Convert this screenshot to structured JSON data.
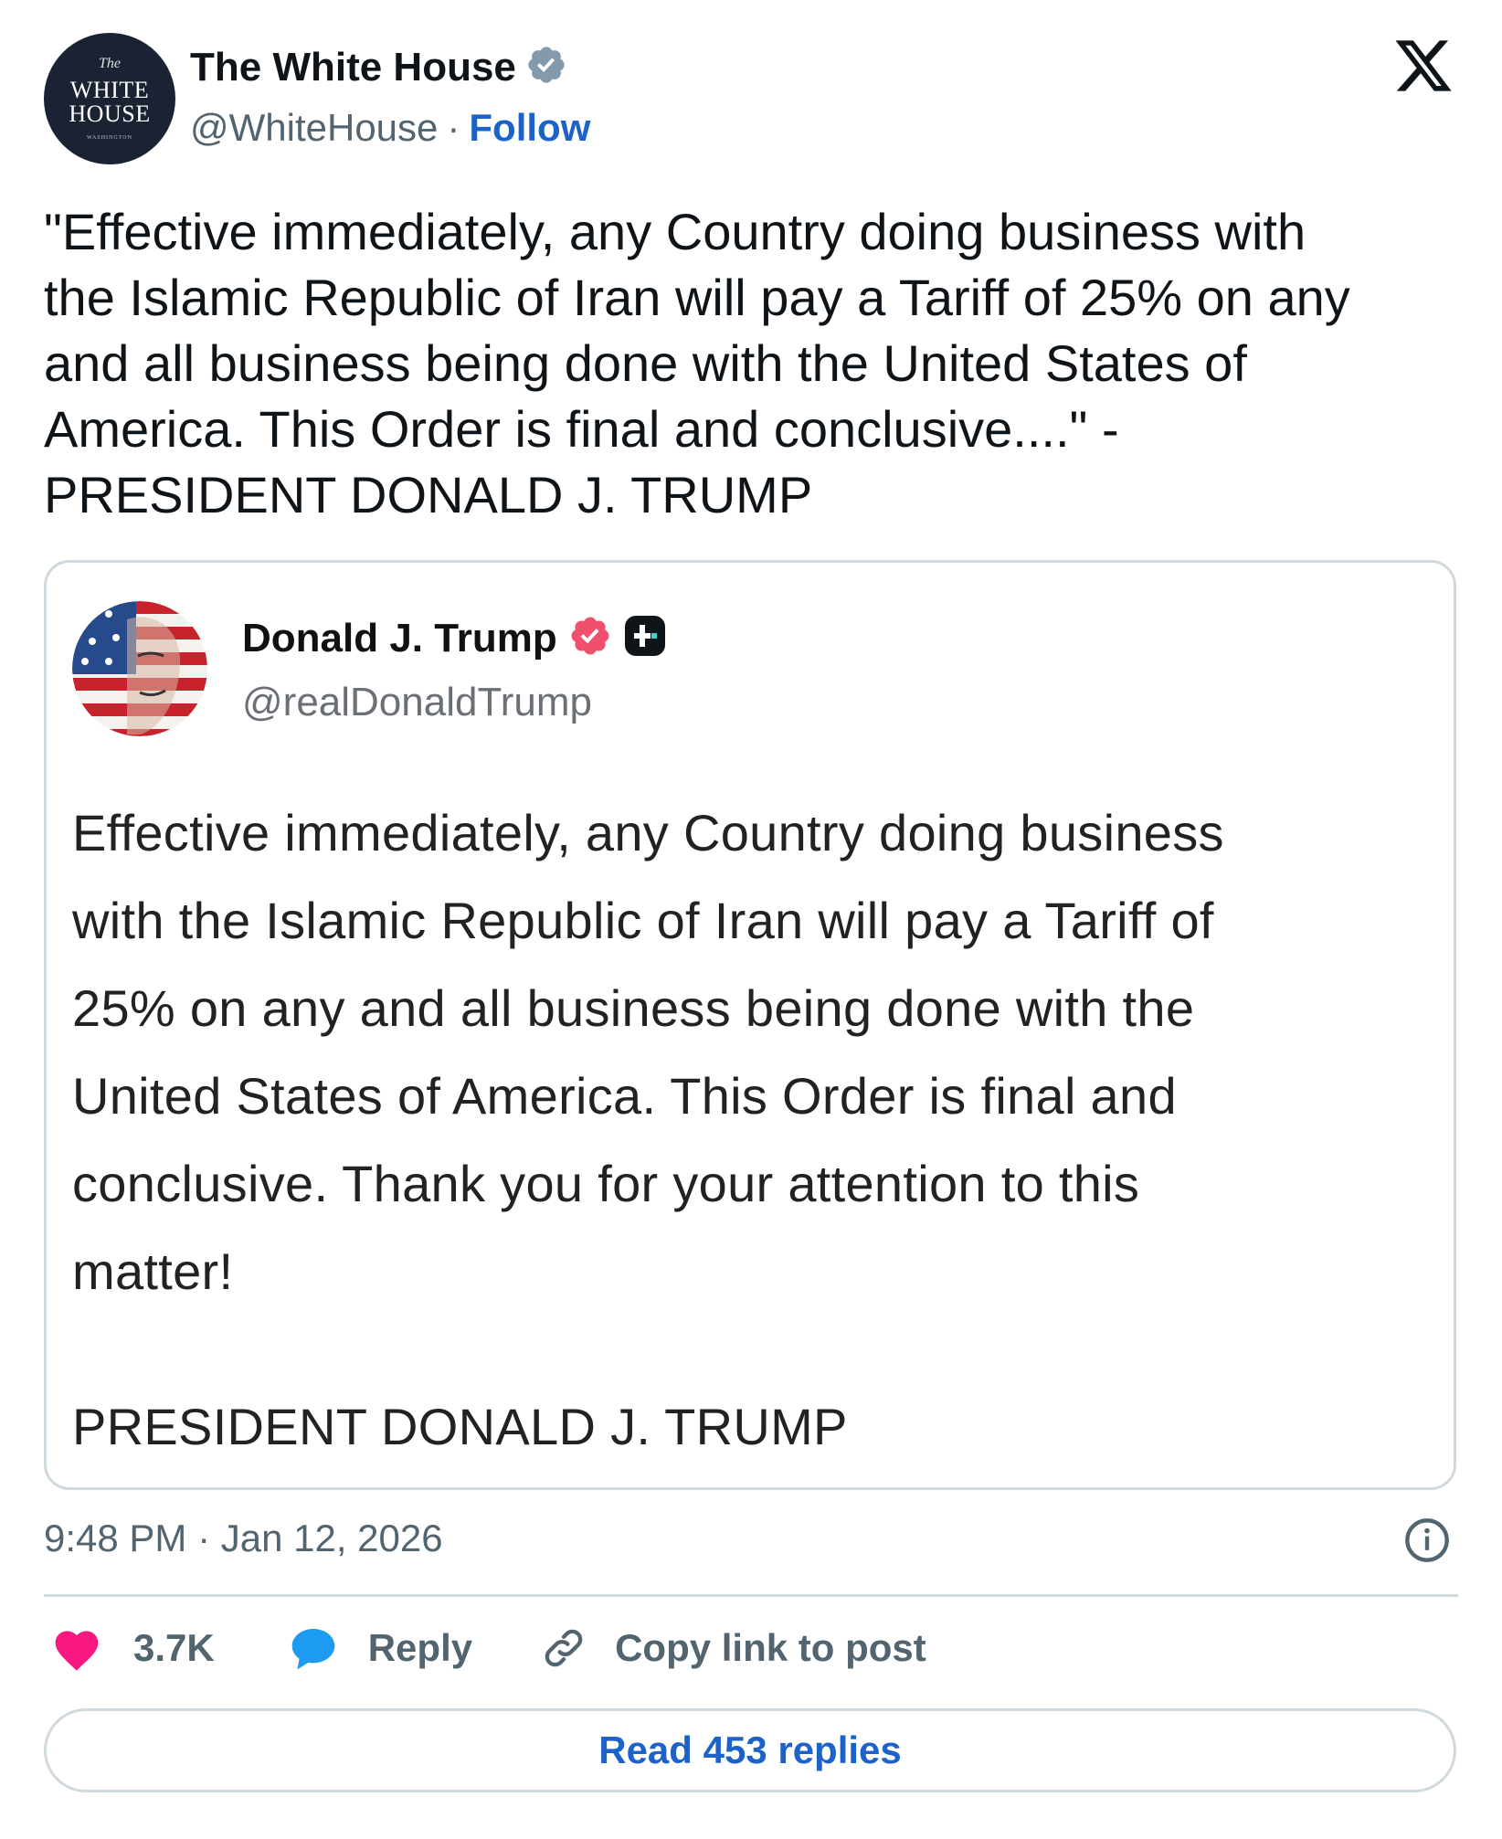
{
  "author": {
    "name": "The White House",
    "handle": "@WhiteHouse",
    "separator": "·",
    "follow_label": "Follow",
    "avatar": {
      "line1": "The",
      "line2": "WHITE",
      "line3": "HOUSE",
      "line4": "WASHINGTON"
    },
    "verified_badge_color": "#829aab"
  },
  "post": {
    "text": "\"Effective immediately, any Country doing business with\nthe Islamic Republic of Iran will pay a Tariff of 25% on any\nand all business being done with the United States of\nAmerica. This Order is final and conclusive....\" -\nPRESIDENT DONALD J. TRUMP"
  },
  "quoted_post": {
    "name": "Donald J. Trump",
    "handle": "@realDonaldTrump",
    "verified_badge_color": "#f0506e",
    "body": "Effective immediately, any Country doing business\nwith the Islamic Republic of Iran will pay a Tariff of\n25% on any and all business being done with the\nUnited States of America. This Order is final and\nconclusive. Thank you for your attention to this\nmatter!",
    "signature": "PRESIDENT DONALD J. TRUMP"
  },
  "meta": {
    "timestamp": "9:48 PM · Jan 12, 2026"
  },
  "actions": {
    "like_count": "3.7K",
    "reply_label": "Reply",
    "copy_label": "Copy link to post",
    "read_replies_label": "Read 453 replies",
    "like_color": "#f91880",
    "reply_color": "#1d9bf0",
    "link_color": "#1d62c8"
  },
  "icons": {
    "brand": "x-logo-icon",
    "info": "info-icon",
    "like": "heart-icon",
    "reply": "speech-bubble-icon",
    "copy": "link-icon"
  }
}
